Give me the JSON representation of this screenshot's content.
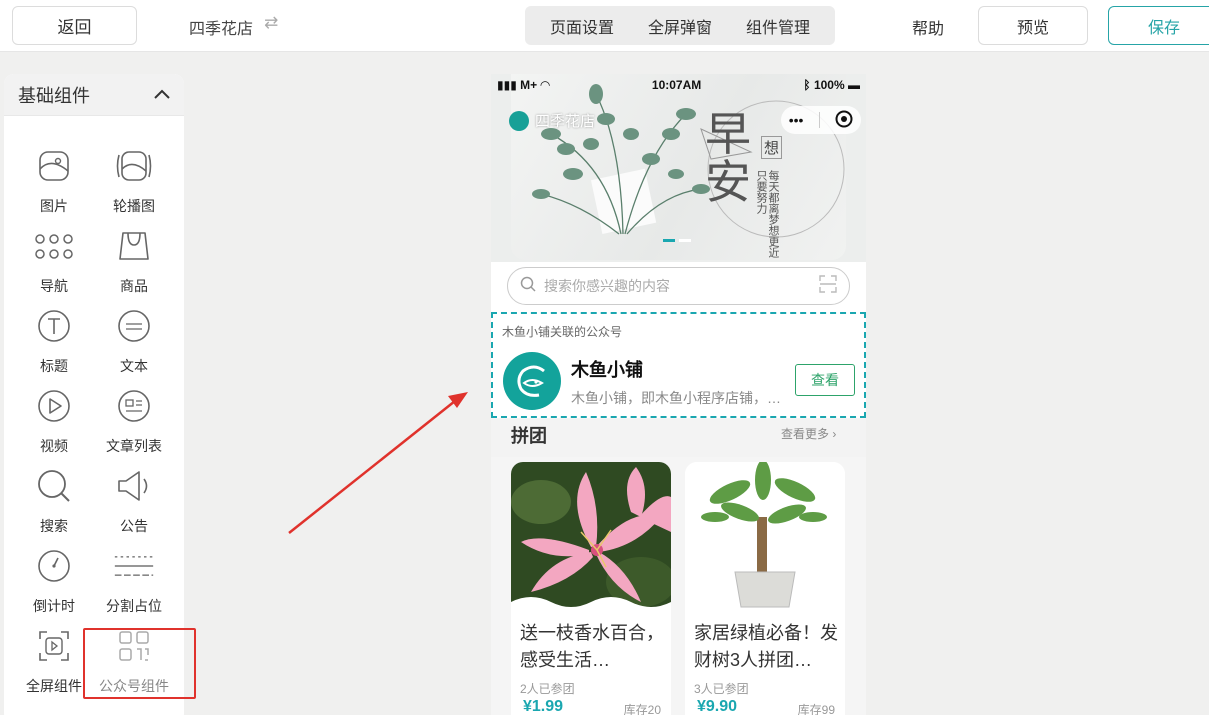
{
  "topbar": {
    "back": "返回",
    "shop_name": "四季花店",
    "swap_icon": "⇄",
    "tabs": [
      "页面设置",
      "全屏弹窗",
      "组件管理"
    ],
    "help": "帮助",
    "preview": "预览",
    "save": "保存"
  },
  "panel": {
    "title": "基础组件",
    "components": [
      {
        "label": "图片",
        "icon": "image-icon"
      },
      {
        "label": "轮播图",
        "icon": "carousel-icon"
      },
      {
        "label": "导航",
        "icon": "nav-icon"
      },
      {
        "label": "商品",
        "icon": "bag-icon"
      },
      {
        "label": "标题",
        "icon": "title-icon"
      },
      {
        "label": "文本",
        "icon": "text-icon"
      },
      {
        "label": "视频",
        "icon": "video-icon"
      },
      {
        "label": "文章列表",
        "icon": "article-list-icon"
      },
      {
        "label": "搜索",
        "icon": "search-icon"
      },
      {
        "label": "公告",
        "icon": "announcement-icon"
      },
      {
        "label": "倒计时",
        "icon": "countdown-icon"
      },
      {
        "label": "分割占位",
        "icon": "divider-icon"
      },
      {
        "label": "全屏组件",
        "icon": "fullscreen-icon"
      },
      {
        "label": "公众号组件",
        "icon": "official-account-icon"
      }
    ]
  },
  "phone": {
    "status": {
      "carrier": "M+",
      "time": "10:07AM",
      "battery": "100%"
    },
    "nav_title": "四季花店",
    "capsule_more": "•••",
    "banner_text": {
      "big": "早安",
      "small": "想",
      "poem": "每天都离梦想更近 只要努力"
    },
    "search_placeholder": "搜索你感兴趣的内容",
    "mp": {
      "caption": "木鱼小铺关联的公众号",
      "name": "木鱼小铺",
      "desc": "木鱼小铺，即木鱼小程序店铺，…",
      "button": "查看"
    },
    "section": {
      "title": "拼团",
      "more": "查看更多"
    },
    "goods": [
      {
        "name": "送一枝香水百合，感受生活…",
        "sold": "2人已参团",
        "price": "¥1.99",
        "stock": "库存20"
      },
      {
        "name": "家居绿植必备！发财树3人拼团…",
        "sold": "3人已参团",
        "price": "¥9.90",
        "stock": "库存99"
      }
    ]
  },
  "colors": {
    "accent": "#1aa7b0",
    "highlight": "#e0322c",
    "button_green": "#2da36a"
  }
}
